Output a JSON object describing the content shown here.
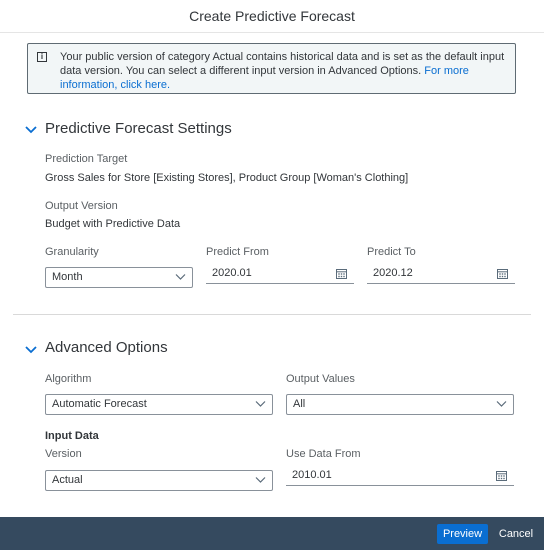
{
  "dialog": {
    "title": "Create Predictive Forecast"
  },
  "info": {
    "message": "Your public version of category Actual contains historical data and is set as the default input data version. You can select a different input version in Advanced Options.",
    "link": "For more information, click here."
  },
  "settings": {
    "title": "Predictive Forecast Settings",
    "prediction_target_label": "Prediction Target",
    "prediction_target_value": "Gross Sales for Store [Existing Stores], Product Group [Woman's Clothing]",
    "output_version_label": "Output Version",
    "output_version_value": "Budget with Predictive Data",
    "granularity_label": "Granularity",
    "granularity_value": "Month",
    "predict_from_label": "Predict From",
    "predict_from_value": "2020.01",
    "predict_to_label": "Predict To",
    "predict_to_value": "2020.12"
  },
  "advanced": {
    "title": "Advanced Options",
    "algorithm_label": "Algorithm",
    "algorithm_value": "Automatic Forecast",
    "output_values_label": "Output Values",
    "output_values_value": "All",
    "input_data_heading": "Input Data",
    "version_label": "Version",
    "version_value": "Actual",
    "use_data_from_label": "Use Data From",
    "use_data_from_value": "2010.01"
  },
  "footer": {
    "preview_label": "Preview",
    "cancel_label": "Cancel"
  },
  "colors": {
    "accent": "#0a6ed1",
    "footer_bg": "#354a5f"
  }
}
